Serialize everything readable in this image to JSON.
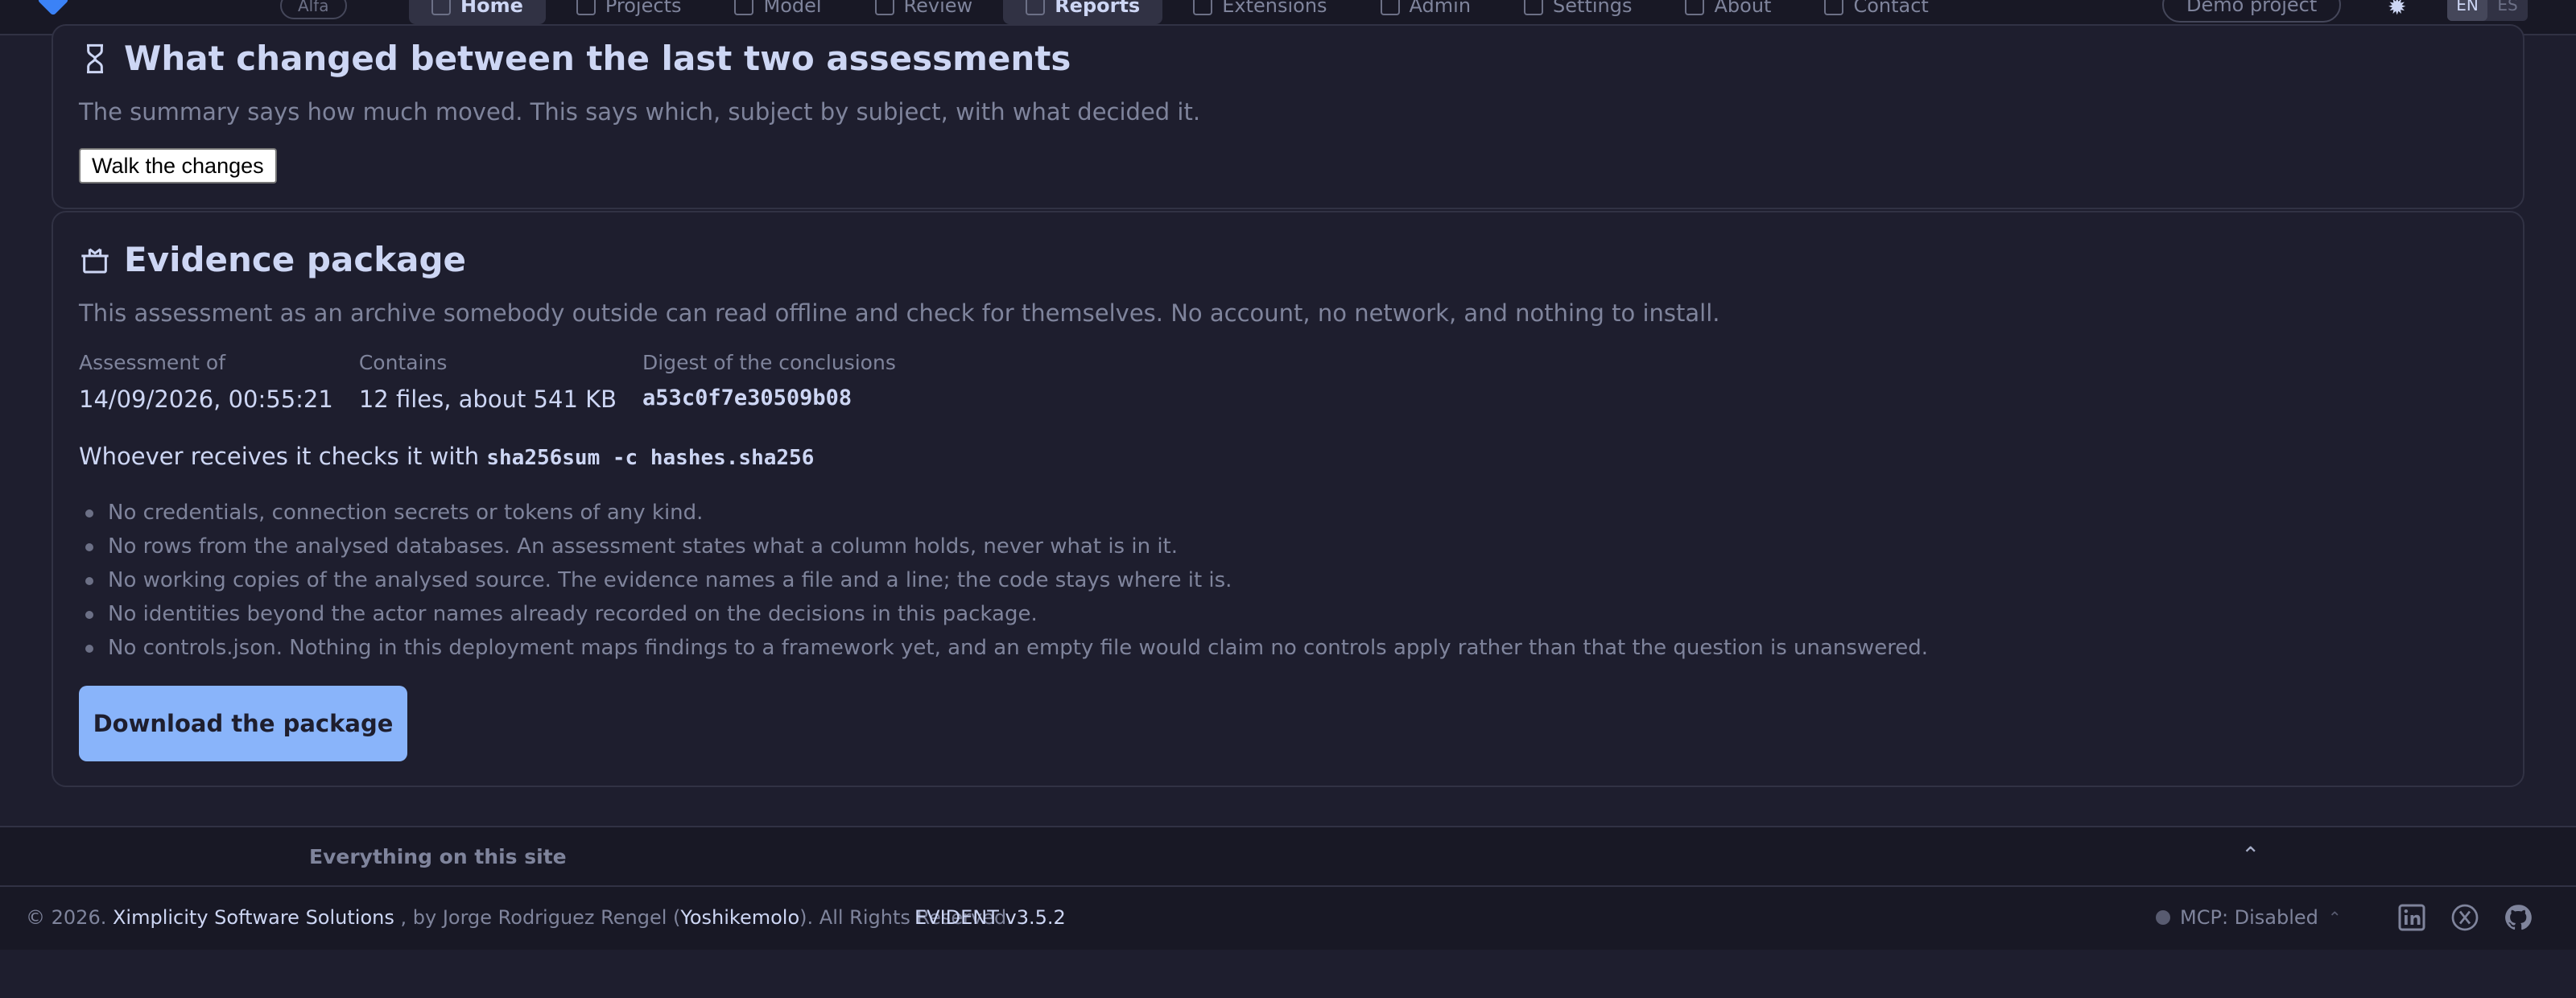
{
  "nav": {
    "badge": "Alfa",
    "items": [
      {
        "label": "Home",
        "active": true
      },
      {
        "label": "Projects",
        "active": false
      },
      {
        "label": "Model",
        "active": false
      },
      {
        "label": "Review",
        "active": false
      },
      {
        "label": "Reports",
        "active": true
      },
      {
        "label": "Extensions",
        "active": false
      },
      {
        "label": "Admin",
        "active": false
      },
      {
        "label": "Settings",
        "active": false
      },
      {
        "label": "About",
        "active": false
      },
      {
        "label": "Contact",
        "active": false
      }
    ],
    "demo_button": "Demo project",
    "lang": [
      "EN",
      "ES"
    ]
  },
  "changes_card": {
    "icon": "hourglass-icon",
    "title": "What changed between the last two assessments",
    "subtitle": "The summary says how much moved. This says which, subject by subject, with what decided it.",
    "button": "Walk the changes"
  },
  "evidence_card": {
    "icon": "package-icon",
    "title": "Evidence package",
    "subtitle": "This assessment as an archive somebody outside can read offline and check for themselves. No account, no network, and nothing to install.",
    "facts": [
      {
        "label": "Assessment of",
        "value": "14/09/2026, 00:55:21",
        "mono": false
      },
      {
        "label": "Contains",
        "value": "12 files, about 541 KB",
        "mono": false
      },
      {
        "label": "Digest of the conclusions",
        "value": "a53c0f7e30509b08",
        "mono": true
      }
    ],
    "verify_prefix": "Whoever receives it checks it with",
    "verify_command": "sha256sum -c hashes.sha256",
    "exclusions": [
      "No credentials, connection secrets or tokens of any kind.",
      "No rows from the analysed databases. An assessment states what a column holds, never what is in it.",
      "No working copies of the analysed source. The evidence names a file and a line; the code stays where it is.",
      "No identities beyond the actor names already recorded on the decisions in this package.",
      "No controls.json. Nothing in this deployment maps findings to a framework yet, and an empty file would claim no controls apply rather than that the question is unanswered."
    ],
    "download_button": "Download the package"
  },
  "sitemap": {
    "label": "Everything on this site"
  },
  "footer": {
    "copyright_prefix": "© 2026.",
    "company": "Ximplicity Software Solutions",
    "by_text": ", by Jorge Rodriguez Rengel (",
    "handle": "Yoshikemolo",
    "rights": "). All Rights Reserved.",
    "version": "EVIDENT v3.5.2",
    "mcp_status": "MCP: Disabled"
  }
}
